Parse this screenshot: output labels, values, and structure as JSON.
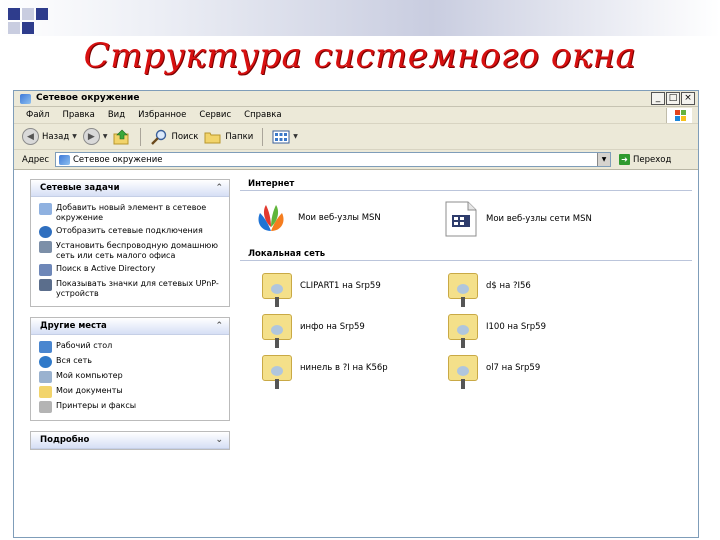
{
  "slide": {
    "title": "Структура системного окна"
  },
  "window": {
    "title": "Сетевое окружение",
    "controls": {
      "minimize": "_",
      "maximize": "□",
      "close": "×"
    }
  },
  "menu": [
    "Файл",
    "Правка",
    "Вид",
    "Избранное",
    "Сервис",
    "Справка"
  ],
  "toolbar": {
    "back": "Назад",
    "search": "Поиск",
    "folders": "Папки"
  },
  "address": {
    "label": "Адрес",
    "value": "Сетевое окружение",
    "go": "Переход"
  },
  "tasks": {
    "heading": "Сетевые задачи",
    "items": [
      "Добавить новый элемент в сетевое окружение",
      "Отобразить сетевые подключения",
      "Установить беспроводную домашнюю сеть или сеть малого офиса",
      "Поиск в Active Directory",
      "Показывать значки для сетевых UPnP-устройств"
    ]
  },
  "places": {
    "heading": "Другие места",
    "items": [
      "Рабочий стол",
      "Вся сеть",
      "Мой компьютер",
      "Мои документы",
      "Принтеры и факсы"
    ]
  },
  "details": {
    "heading": "Подробно"
  },
  "groups": {
    "internet": {
      "heading": "Интернет",
      "items": [
        "Мои веб-узлы MSN",
        "Мои веб-узлы сети MSN"
      ]
    },
    "lan": {
      "heading": "Локальная сеть",
      "items": [
        "CLIPART1 на Srp59",
        "d$ на ?I56",
        "инфо на Srp59",
        "I100 на Srp59",
        "нинель в ?I на K56p",
        "ol7 на Srp59"
      ]
    }
  },
  "icons": {
    "back": "back-arrow-icon",
    "forward": "forward-arrow-icon",
    "up": "up-folder-icon",
    "search": "search-icon",
    "folders": "folders-icon",
    "views": "views-icon",
    "msn": "msn-butterfly-icon",
    "doc": "web-page-document-icon",
    "share": "network-share-folder-icon"
  }
}
